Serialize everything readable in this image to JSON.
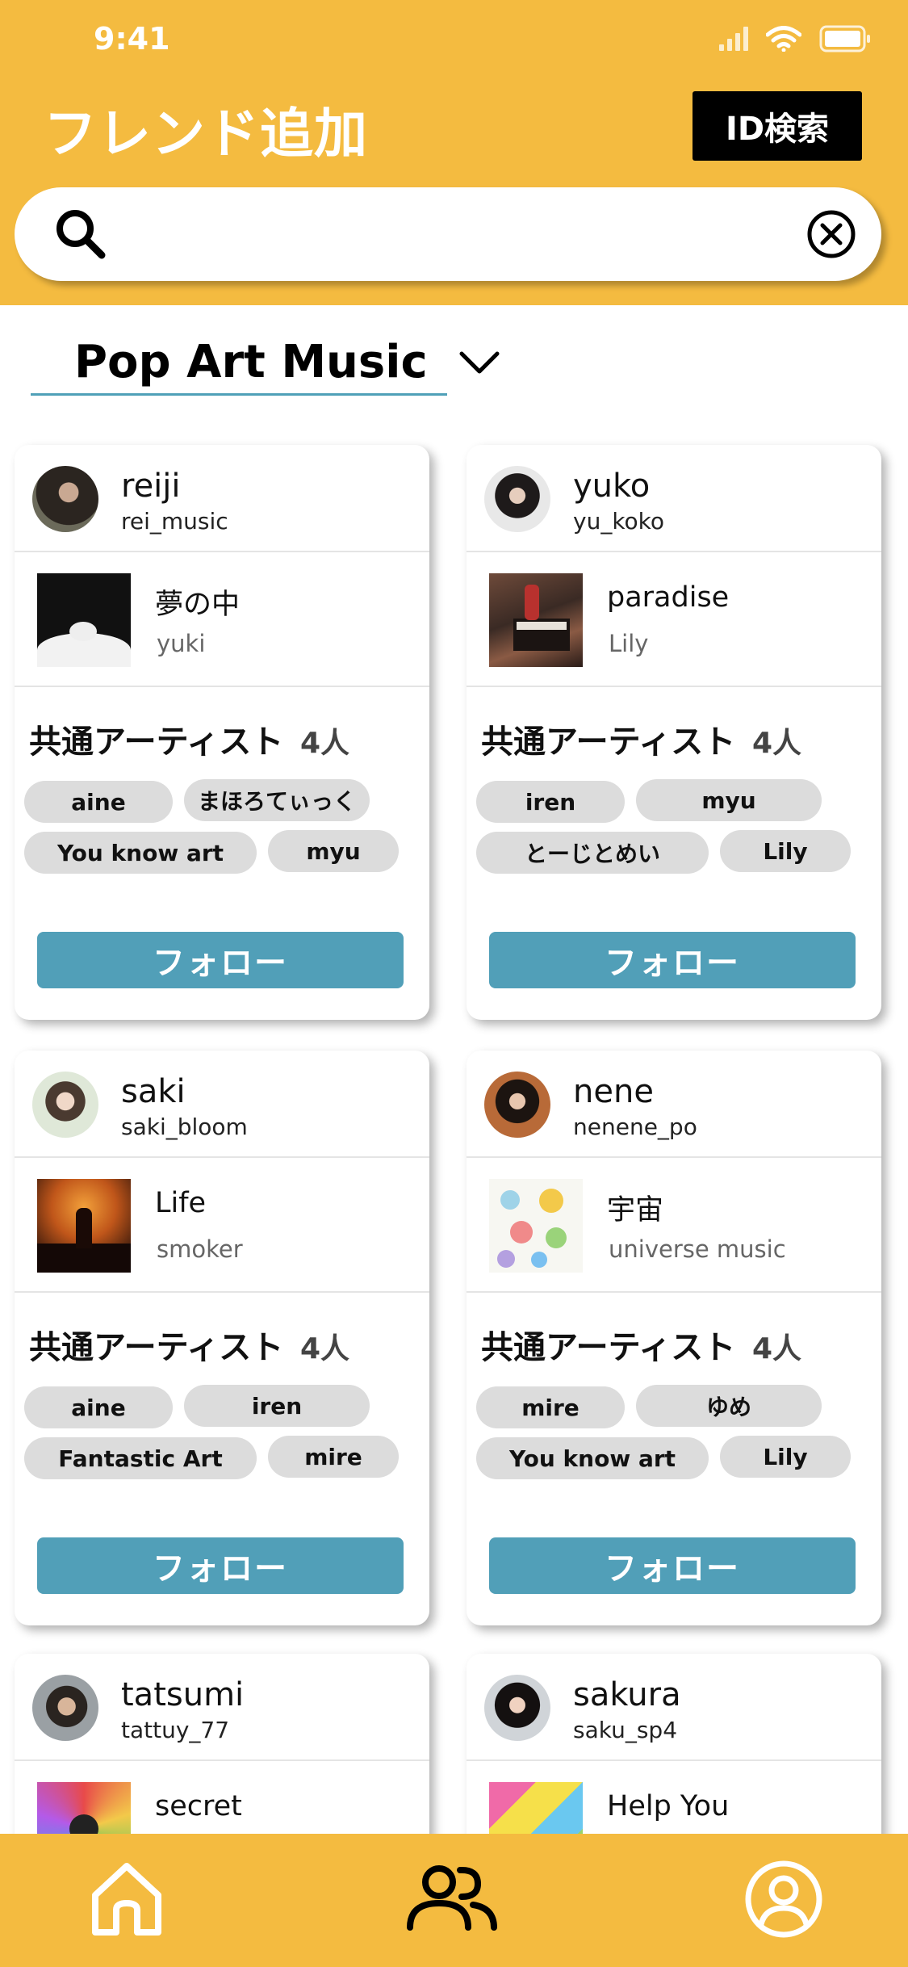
{
  "status_bar": {
    "time": "9:41"
  },
  "header": {
    "title": "フレンド追加",
    "id_search_label": "ID検索",
    "search": {
      "value": "",
      "placeholder": ""
    }
  },
  "category": {
    "selected": "Pop Art Music"
  },
  "common_label": "共通アーティスト",
  "follow_label": "フォロー",
  "cards": [
    {
      "name": "reiji",
      "id": "rei_music",
      "song": {
        "title": "夢の中",
        "artist": "yuki"
      },
      "common_count": "4人",
      "common_artists": [
        "aine",
        "まほろてぃっく",
        "You know art",
        "myu"
      ]
    },
    {
      "name": "yuko",
      "id": "yu_koko",
      "song": {
        "title": "paradise",
        "artist": "Lily"
      },
      "common_count": "4人",
      "common_artists": [
        "iren",
        "myu",
        "とーじとめい",
        "Lily"
      ]
    },
    {
      "name": "saki",
      "id": "saki_bloom",
      "song": {
        "title": "Life",
        "artist": "smoker"
      },
      "common_count": "4人",
      "common_artists": [
        "aine",
        "iren",
        "Fantastic Art",
        "mire"
      ]
    },
    {
      "name": "nene",
      "id": "nenene_po",
      "song": {
        "title": "宇宙",
        "artist": "universe music"
      },
      "common_count": "4人",
      "common_artists": [
        "mire",
        "ゆめ",
        "You know art",
        "Lily"
      ]
    },
    {
      "name": "tatsumi",
      "id": "tattuy_77",
      "song": {
        "title": "secret",
        "artist": ""
      }
    },
    {
      "name": "sakura",
      "id": "saku_sp4",
      "song": {
        "title": "Help You",
        "artist": ""
      }
    }
  ],
  "colors": {
    "header": "#F4BB40",
    "follow_button": "#519FB8",
    "chip": "#dcdcdc",
    "underline": "#4FA0B8"
  },
  "bottom_nav": {
    "items": [
      "home-icon",
      "friends-icon",
      "profile-icon"
    ],
    "active": "friends-icon"
  }
}
